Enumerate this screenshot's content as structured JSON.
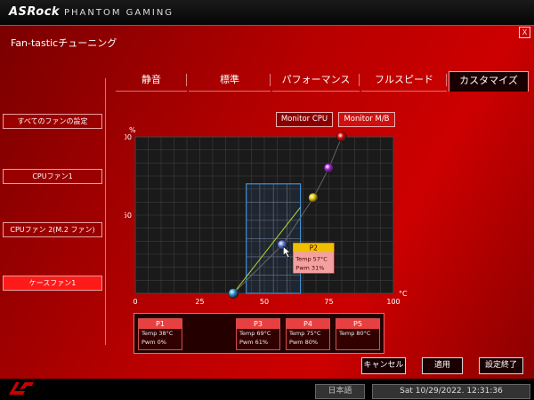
{
  "brand": {
    "name": "ASRock",
    "product": "PHANTOM GAMING"
  },
  "window": {
    "title": "Fan-tasticチューニング",
    "close_label": "X"
  },
  "tabs": [
    {
      "label": "静音",
      "active": false
    },
    {
      "label": "標準",
      "active": false
    },
    {
      "label": "パフォーマンス",
      "active": false
    },
    {
      "label": "フルスピード",
      "active": false
    },
    {
      "label": "カスタマイズ",
      "active": true
    }
  ],
  "sidebar": {
    "items": [
      {
        "label": "すべてのファンの設定",
        "active": false
      },
      {
        "label": "CPUファン1",
        "active": false
      },
      {
        "label": "CPUファン 2(M.2 ファン)",
        "active": false
      },
      {
        "label": "ケースファン1",
        "active": true
      }
    ]
  },
  "monitor": {
    "cpu_label": "Monitor CPU",
    "mb_label": "Monitor M/B",
    "selected": "Monitor M/B"
  },
  "chart_data": {
    "type": "line",
    "xlabel": "°C",
    "ylabel": "%",
    "xlim": [
      0,
      100
    ],
    "ylim": [
      0,
      100
    ],
    "x_ticks": [
      "0",
      "25",
      "50",
      "75",
      "100"
    ],
    "y_ticks": [
      "50",
      "100"
    ],
    "grid": true,
    "points": [
      {
        "name": "P1",
        "x": 38,
        "y": 0,
        "color": "#2a9ad8"
      },
      {
        "name": "P2",
        "x": 57,
        "y": 31,
        "color": "#5a78e0"
      },
      {
        "name": "P3",
        "x": 69,
        "y": 61,
        "color": "#e0c000"
      },
      {
        "name": "P4",
        "x": 75,
        "y": 80,
        "color": "#a020d0"
      },
      {
        "name": "P5",
        "x": 80,
        "y": 100,
        "color": "#e00000"
      }
    ],
    "current_line": {
      "x": [
        38,
        64
      ],
      "y": [
        0,
        55
      ]
    },
    "selection": {
      "x_range": [
        43,
        64
      ],
      "y_range": [
        0,
        70
      ]
    },
    "tooltip": {
      "title": "P2",
      "temp": "Temp 57°C",
      "pwm": "Pwm  31%"
    }
  },
  "points_panel": [
    {
      "name": "P1",
      "temp": "Temp 38°C",
      "pwm": "Pwm  0%"
    },
    {
      "name": "P3",
      "temp": "Temp 69°C",
      "pwm": "Pwm  61%"
    },
    {
      "name": "P4",
      "temp": "Temp 75°C",
      "pwm": "Pwm  80%"
    },
    {
      "name": "P5",
      "temp": "Temp 80°C",
      "pwm": ""
    }
  ],
  "actions": {
    "cancel": "キャンセル",
    "apply": "適用",
    "finish": "設定終了"
  },
  "footer": {
    "language": "日本語",
    "datetime": "Sat 10/29/2022. 12:31:36"
  }
}
